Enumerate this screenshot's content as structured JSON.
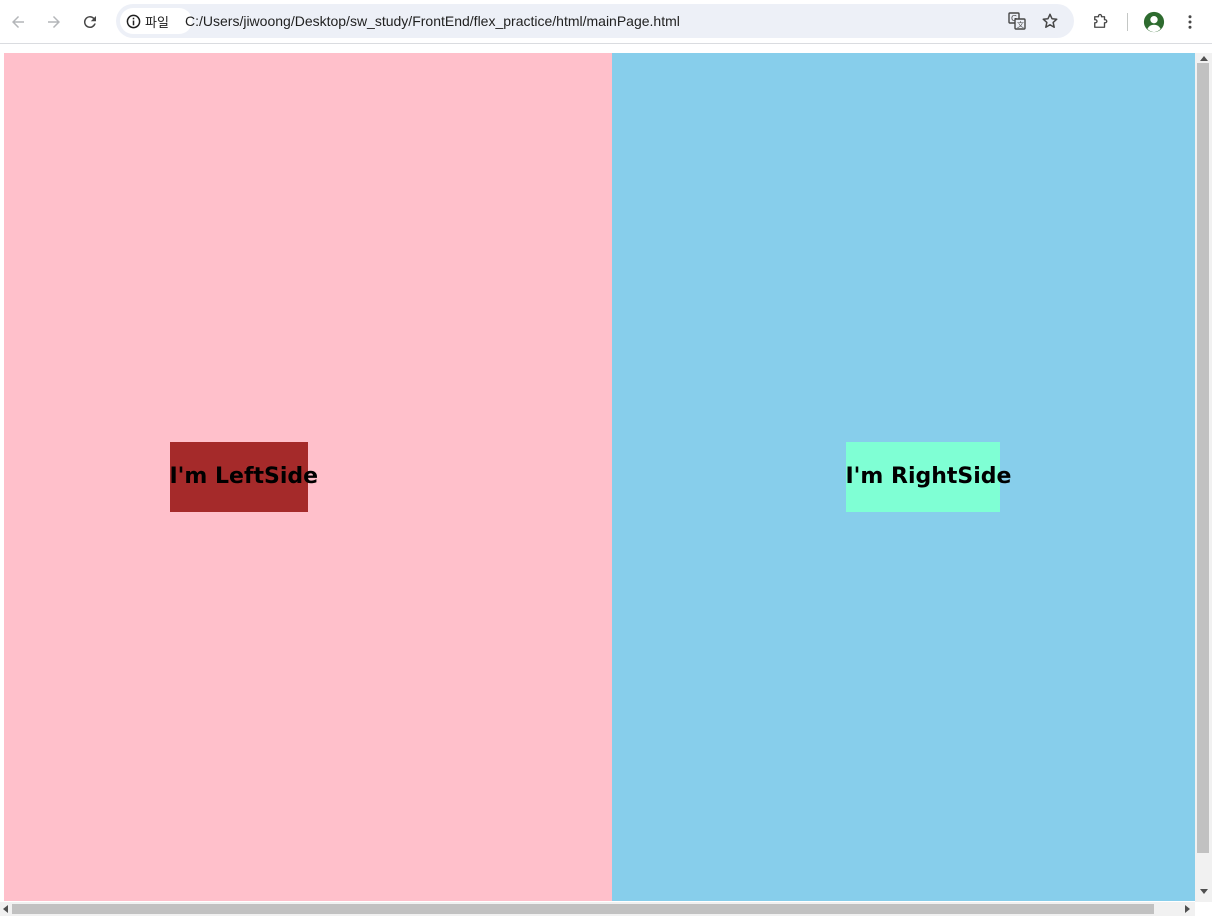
{
  "browser": {
    "security_chip_label": "파일",
    "url": "C:/Users/jiwoong/Desktop/sw_study/FrontEnd/flex_practice/html/mainPage.html",
    "icons": [
      "back-icon",
      "forward-icon",
      "reload-icon",
      "info-icon",
      "translate-icon",
      "star-icon",
      "extensions-icon",
      "profile-icon",
      "menu-icon"
    ]
  },
  "page": {
    "left": {
      "label": "I'm LeftSide",
      "background": "#FFC0CB",
      "box_color": "#A52A2A"
    },
    "right": {
      "label": "I'm RightSide",
      "background": "#87CEEB",
      "box_color": "#7FFFD4"
    }
  }
}
